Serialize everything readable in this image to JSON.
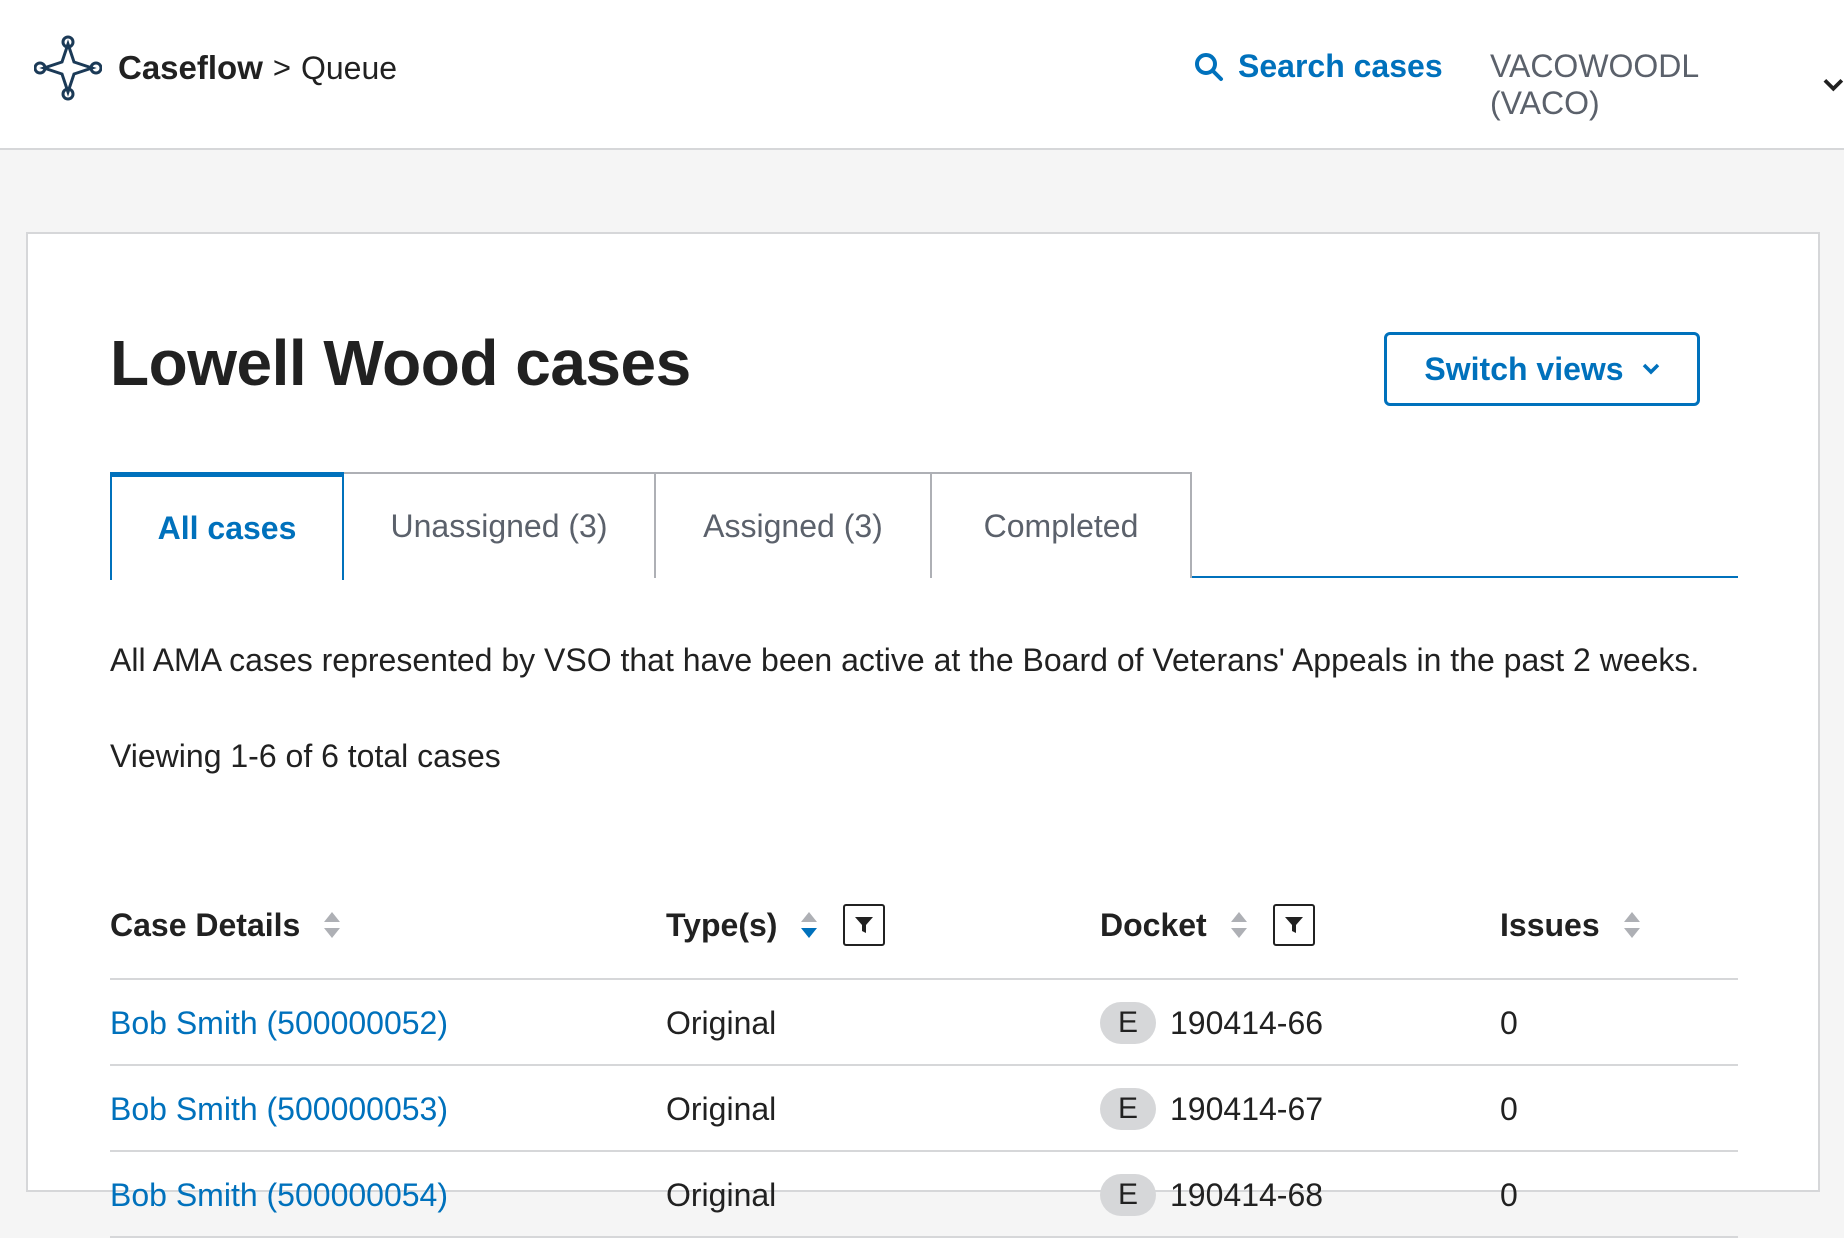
{
  "header": {
    "app_name": "Caseflow",
    "separator": ">",
    "page_name": "Queue",
    "search_label": "Search cases",
    "user_label": "VACOWOODL (VACO)"
  },
  "main": {
    "title": "Lowell Wood cases",
    "switch_views_label": "Switch views",
    "tabs": [
      {
        "label": "All cases",
        "active": true
      },
      {
        "label": "Unassigned (3)",
        "active": false
      },
      {
        "label": "Assigned (3)",
        "active": false
      },
      {
        "label": "Completed",
        "active": false
      }
    ],
    "description": "All AMA cases represented by VSO that have been active at the Board of Veterans' Appeals in the past 2 weeks.",
    "viewing": "Viewing 1-6 of 6 total cases"
  },
  "table": {
    "columns": [
      {
        "label": "Case Details",
        "sortable": true,
        "filterable": false
      },
      {
        "label": "Type(s)",
        "sortable": true,
        "filterable": true,
        "sorted": "desc"
      },
      {
        "label": "Docket",
        "sortable": true,
        "filterable": true
      },
      {
        "label": "Issues",
        "sortable": true,
        "filterable": false
      }
    ],
    "rows": [
      {
        "case": "Bob Smith (500000052)",
        "type": "Original",
        "docket_type": "E",
        "docket_number": "190414-66",
        "issues": "0"
      },
      {
        "case": "Bob Smith (500000053)",
        "type": "Original",
        "docket_type": "E",
        "docket_number": "190414-67",
        "issues": "0"
      },
      {
        "case": "Bob Smith (500000054)",
        "type": "Original",
        "docket_type": "E",
        "docket_number": "190414-68",
        "issues": "0"
      }
    ]
  },
  "colors": {
    "accent": "#0071bc",
    "text": "#212121",
    "muted": "#5b616b",
    "border": "#d6d7d9",
    "background": "#f5f5f5"
  },
  "icons": {
    "logo": "caseflow-logo-icon",
    "search": "search-icon",
    "user_menu": "chevron-down-icon",
    "switch_views": "chevron-down-icon",
    "sort": "sort-icon",
    "filter": "filter-icon"
  }
}
